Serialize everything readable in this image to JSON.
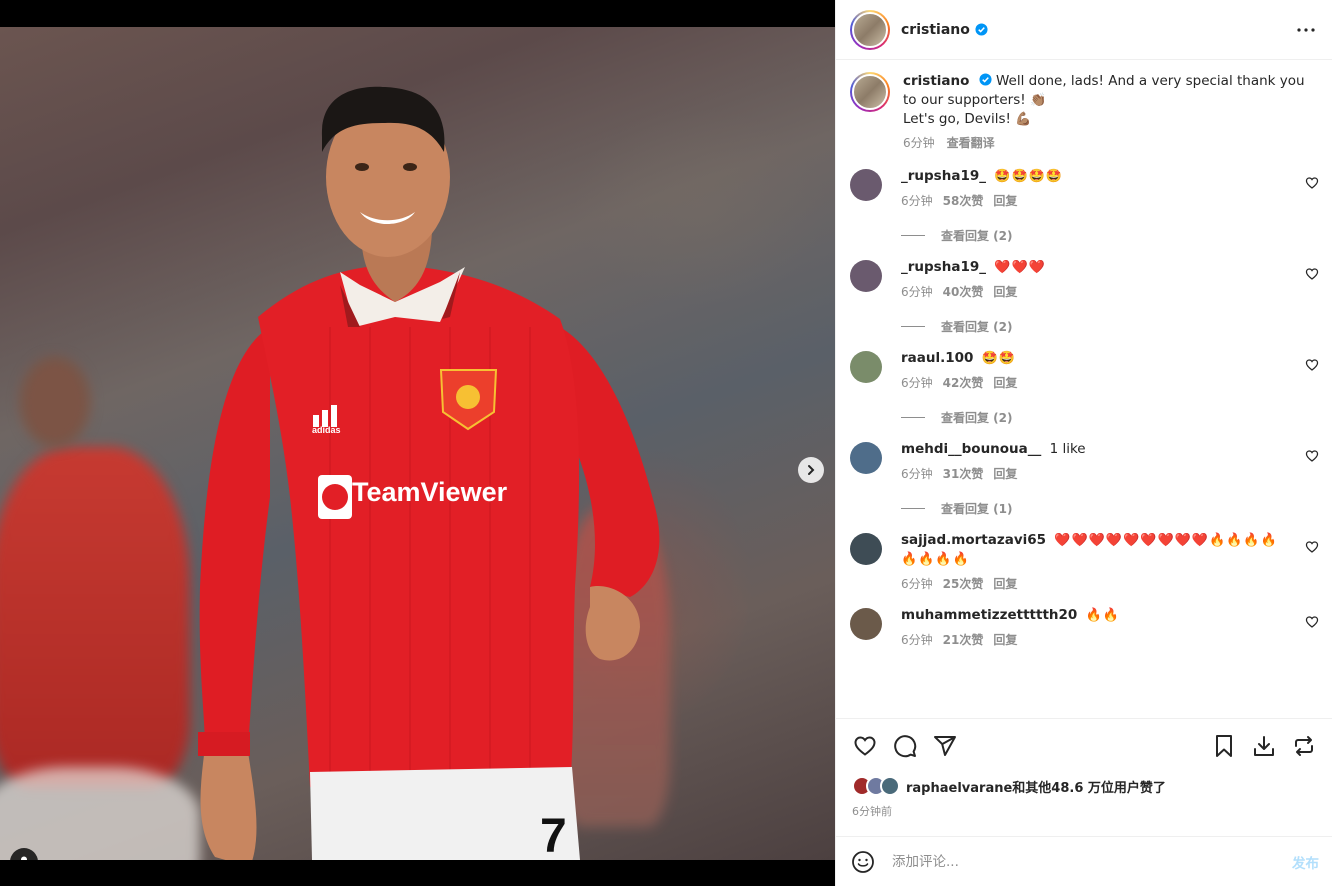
{
  "post": {
    "author": "cristiano",
    "verified": true,
    "caption_parts": [
      "Well done, lads! And a very special thank you to our supporters! ",
      "\n",
      "Let's go, Devils! "
    ],
    "caption_emoji_1": "👏🏽",
    "caption_emoji_2": "💪🏽",
    "time": "6分钟",
    "translate": "查看翻译"
  },
  "icons": {
    "more": "more-horizontal-icon",
    "verified": "verified-badge-icon",
    "next": "chevron-right-icon",
    "tags": "user-tag-icon",
    "like": "heart-icon",
    "comment": "comment-bubble-icon",
    "share": "paper-plane-icon",
    "save": "bookmark-icon",
    "download": "download-icon",
    "repost": "repost-icon",
    "emoji": "smiley-icon"
  },
  "comments": [
    {
      "user": "_rupsha19_",
      "text": "🤩🤩🤩🤩",
      "time": "6分钟",
      "likes": "58次赞",
      "reply": "回复",
      "view_replies": "查看回复 (2)",
      "avatar": "#6a5a6e"
    },
    {
      "user": "_rupsha19_",
      "text": "❤️❤️❤️",
      "time": "6分钟",
      "likes": "40次赞",
      "reply": "回复",
      "view_replies": "查看回复 (2)",
      "avatar": "#6a5a6e"
    },
    {
      "user": "raaul.100",
      "text": "🤩🤩",
      "time": "6分钟",
      "likes": "42次赞",
      "reply": "回复",
      "view_replies": "查看回复 (2)",
      "avatar": "#7a8c6a"
    },
    {
      "user": "mehdi__bounoua__",
      "text": "1 like",
      "time": "6分钟",
      "likes": "31次赞",
      "reply": "回复",
      "view_replies": "查看回复 (1)",
      "avatar": "#4f6d8a"
    },
    {
      "user": "sajjad.mortazavi65",
      "text": "❤️❤️❤️❤️❤️❤️❤️❤️❤️🔥🔥🔥🔥🔥🔥🔥🔥",
      "time": "6分钟",
      "likes": "25次赞",
      "reply": "回复",
      "view_replies": "",
      "avatar": "#3e4c55"
    },
    {
      "user": "muhammetizzettttth20",
      "text": "🔥🔥",
      "time": "6分钟",
      "likes": "21次赞",
      "reply": "回复",
      "view_replies": "",
      "avatar": "#6b5a4a"
    }
  ],
  "likes": {
    "user": "raphaelvarane",
    "summary": "和其他48.6 万位用户赞了"
  },
  "posted_ago": "6分钟前",
  "add_comment": {
    "placeholder": "添加评论...",
    "post": "发布"
  },
  "colors": {
    "brand_blue": "#0095f6",
    "muted": "#8e8e8e",
    "verified": "#0095f6"
  }
}
